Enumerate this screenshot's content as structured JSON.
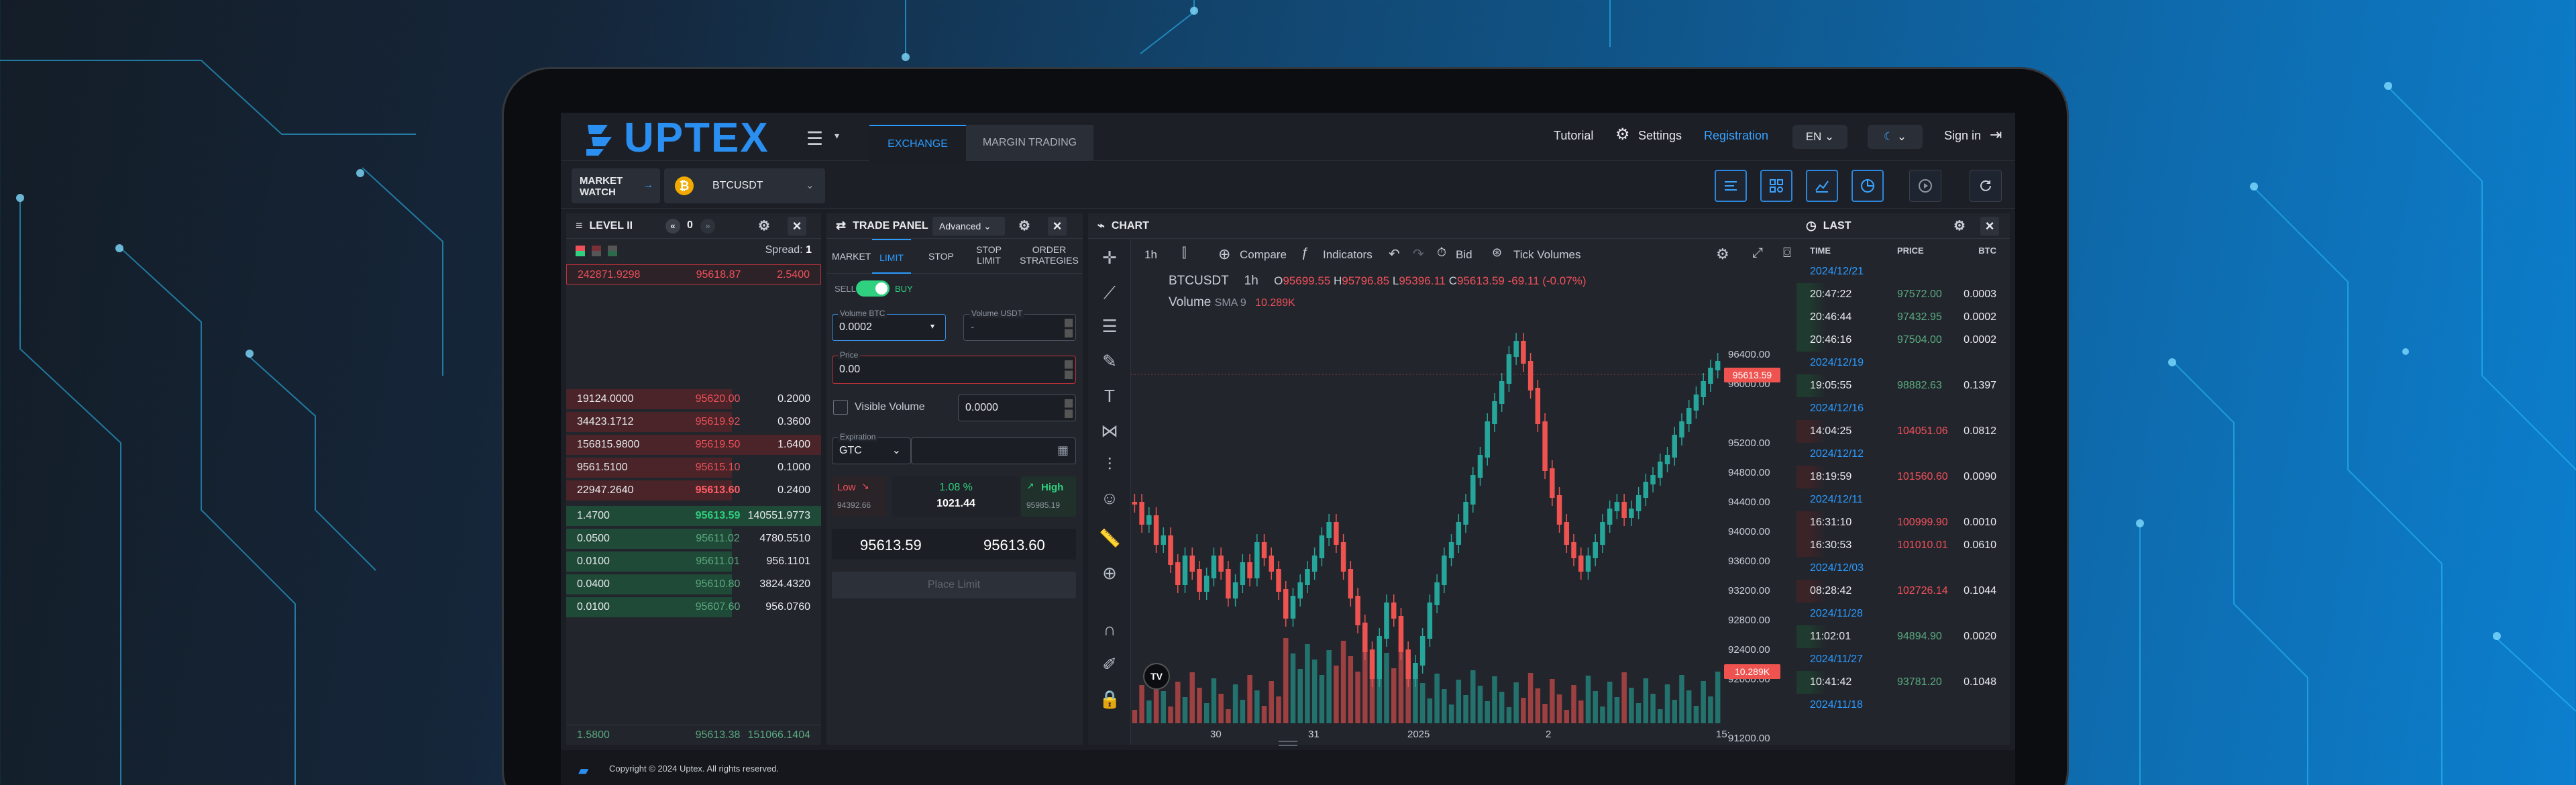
{
  "topnav": {
    "logo": "UPTEX",
    "tabs": [
      "EXCHANGE",
      "MARGIN TRADING"
    ],
    "tutorial": "Tutorial",
    "settings": "Settings",
    "registration": "Registration",
    "lang": "EN",
    "signin": "Sign in"
  },
  "subbar": {
    "market_watch": "MARKET WATCH",
    "pair": "BTCUSDT"
  },
  "level2": {
    "title": "LEVEL II",
    "depth": "0",
    "spread_label": "Spread:",
    "spread_value": "1",
    "top_ask": [
      "242871.9298",
      "95618.87",
      "2.5400"
    ],
    "asks": [
      [
        "19124.0000",
        "95620.00",
        "0.2000"
      ],
      [
        "34423.1712",
        "95619.92",
        "0.3600"
      ],
      [
        "156815.9800",
        "95619.50",
        "1.6400"
      ],
      [
        "9561.5100",
        "95615.10",
        "0.1000"
      ],
      [
        "22947.2640",
        "95613.60",
        "0.2400"
      ]
    ],
    "bids": [
      [
        "1.4700",
        "95613.59",
        "140551.9773"
      ],
      [
        "0.0500",
        "95611.02",
        "4780.5510"
      ],
      [
        "0.0100",
        "95611.01",
        "956.1101"
      ],
      [
        "0.0400",
        "95610.80",
        "3824.4320"
      ],
      [
        "0.0100",
        "95607.60",
        "956.0760"
      ]
    ],
    "bottom": [
      "1.5800",
      "95613.38",
      "151066.1404"
    ]
  },
  "trade": {
    "title": "TRADE PANEL",
    "mode": "Advanced",
    "tabs": [
      "MARKET",
      "LIMIT",
      "STOP",
      "STOP LIMIT",
      "ORDER STRATEGIES"
    ],
    "sell": "SELL",
    "buy": "BUY",
    "vol_btc_label": "Volume BTC",
    "vol_btc": "0.0002",
    "vol_usdt_label": "Volume USDT",
    "vol_usdt": "-",
    "price_label": "Price",
    "price": "0.00",
    "visible_volume": "Visible Volume",
    "visible_value": "0.0000",
    "expiration_label": "Expiration",
    "expiration": "GTC",
    "low_label": "Low",
    "low": "94392.66",
    "change": "1.08 %",
    "last": "1021.44",
    "high_label": "High",
    "high": "95985.19",
    "bid": "95613.59",
    "ask": "95613.60",
    "place": "Place Limit"
  },
  "chart": {
    "title": "CHART",
    "interval": "1h",
    "compare": "Compare",
    "indicators": "Indicators",
    "bid": "Bid",
    "tick_volumes": "Tick Volumes",
    "symbol": "BTCUSDT",
    "sym_interval": "1h",
    "o": "95699.55",
    "h": "95796.85",
    "l": "95396.11",
    "c": "95613.59",
    "chg": "-69.11 (-0.07%)",
    "vol_label": "Volume",
    "sma": "SMA 9",
    "vol_val": "10.289K",
    "y_labels": [
      "96400.00",
      "96000.00",
      "95200.00",
      "94800.00",
      "94400.00",
      "94000.00",
      "93600.00",
      "93200.00",
      "92800.00",
      "92400.00",
      "92000.00",
      "91200.00"
    ],
    "price_tag": "95613.59",
    "vol_tag": "10.289K",
    "x_labels": [
      "30",
      "31",
      "2025",
      "2"
    ],
    "x_tail": "15:",
    "tv": "TV",
    "colors": {
      "up": "#26a69a",
      "down": "#ef5350"
    }
  },
  "last": {
    "title": "LAST",
    "headers": [
      "TIME",
      "PRICE",
      "BTC"
    ],
    "rows": [
      {
        "type": "date",
        "text": "2024/12/21"
      },
      {
        "type": "trade",
        "t": "20:47:22",
        "p": "97572.00",
        "v": "0.0003",
        "side": "buy"
      },
      {
        "type": "trade",
        "t": "20:46:44",
        "p": "97432.95",
        "v": "0.0002",
        "side": "buy"
      },
      {
        "type": "trade",
        "t": "20:46:16",
        "p": "97504.00",
        "v": "0.0002",
        "side": "buy"
      },
      {
        "type": "date",
        "text": "2024/12/19"
      },
      {
        "type": "trade",
        "t": "19:05:55",
        "p": "98882.63",
        "v": "0.1397",
        "side": "buy"
      },
      {
        "type": "date",
        "text": "2024/12/16"
      },
      {
        "type": "trade",
        "t": "14:04:25",
        "p": "104051.06",
        "v": "0.0812",
        "side": "sell"
      },
      {
        "type": "date",
        "text": "2024/12/12"
      },
      {
        "type": "trade",
        "t": "18:19:59",
        "p": "101560.60",
        "v": "0.0090",
        "side": "sell"
      },
      {
        "type": "date",
        "text": "2024/12/11"
      },
      {
        "type": "trade",
        "t": "16:31:10",
        "p": "100999.90",
        "v": "0.0010",
        "side": "sell"
      },
      {
        "type": "trade",
        "t": "16:30:53",
        "p": "101010.01",
        "v": "0.0610",
        "side": "sell"
      },
      {
        "type": "date",
        "text": "2024/12/03"
      },
      {
        "type": "trade",
        "t": "08:28:42",
        "p": "102726.14",
        "v": "0.1044",
        "side": "sell"
      },
      {
        "type": "date",
        "text": "2024/11/28"
      },
      {
        "type": "trade",
        "t": "11:02:01",
        "p": "94894.90",
        "v": "0.0020",
        "side": "buy"
      },
      {
        "type": "date",
        "text": "2024/11/27"
      },
      {
        "type": "trade",
        "t": "10:41:42",
        "p": "93781.20",
        "v": "0.1048",
        "side": "buy"
      },
      {
        "type": "date",
        "text": "2024/11/18"
      }
    ]
  },
  "footer": {
    "copyright": "Copyright © 2024 Uptex. All rights reserved."
  }
}
